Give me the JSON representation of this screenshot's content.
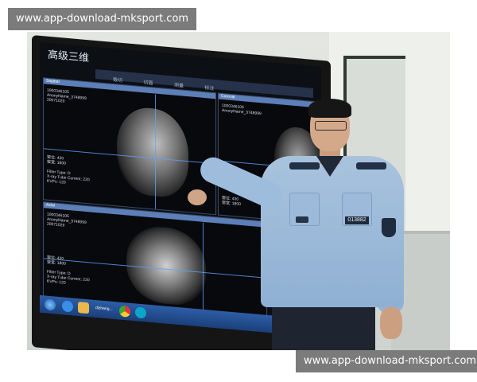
{
  "watermarks": {
    "top": "www.app-download-mksport.com",
    "bottom": "www.app-download-mksport.com"
  },
  "screen": {
    "app_title": "高级三维",
    "tabs": [
      "裁切",
      "切面",
      "测量",
      "标注"
    ],
    "panels": [
      {
        "bar_label": "Sagittal",
        "meta_top": "1000346105\nAnonyName_3748999\n20071029",
        "meta_bottom": "窗位: 430\n窗宽: 1800\n\nFilter Type: D\nX-ray Tube Current: 220\nKVPs: 120"
      },
      {
        "bar_label": "Coronal",
        "meta_top": "1000346105\nAnonyName_3748999",
        "meta_bottom": "窗位: 430\n窗宽: 1800"
      },
      {
        "bar_label": "Axial",
        "meta_top": "1000346105\nAnonyName_3748999\n20071029",
        "meta_bottom": "窗位: 430\n窗宽: 1800\n\nFilter Type: D\nX-ray Tube Current: 220\nKVPs: 120"
      }
    ],
    "taskbar_label": "dizhang..."
  },
  "officer": {
    "badge_number": "013882"
  },
  "colors": {
    "watermark_bg": "#7b7b7b",
    "shirt": "#a9c3de",
    "screen_accent": "#5d7fb8",
    "taskbar": "#2d5ea6"
  }
}
